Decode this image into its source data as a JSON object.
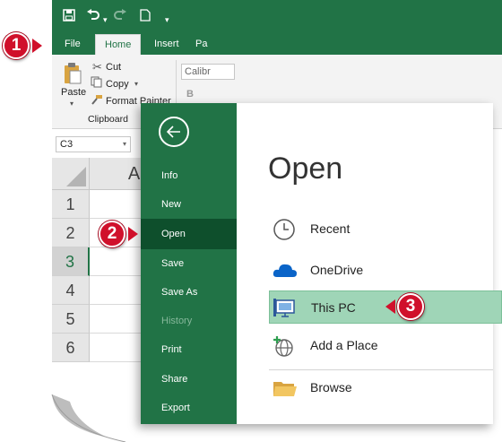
{
  "excel": {
    "quick_access": {
      "save_icon": "save-icon",
      "undo_icon": "undo-icon",
      "redo_icon": "redo-icon",
      "new_icon": "new-file-icon"
    },
    "tabs": [
      {
        "label": "File"
      },
      {
        "label": "Home"
      },
      {
        "label": "Insert"
      },
      {
        "label": "Pa"
      }
    ],
    "ribbon": {
      "paste_label": "Paste",
      "cut_label": "Cut",
      "copy_label": "Copy",
      "format_painter_label": "Format Painter",
      "font_name_partial": "Calibr",
      "bold_label": "B",
      "clipboard_group_label": "Clipboard"
    },
    "name_box": "C3",
    "column_header": "A",
    "row_headers": [
      "1",
      "2",
      "3",
      "4",
      "5",
      "6"
    ],
    "selected_row": "3"
  },
  "backstage": {
    "nav": [
      {
        "label": "Info",
        "state": "normal"
      },
      {
        "label": "New",
        "state": "normal"
      },
      {
        "label": "Open",
        "state": "active"
      },
      {
        "label": "Save",
        "state": "normal"
      },
      {
        "label": "Save As",
        "state": "normal"
      },
      {
        "label": "History",
        "state": "disabled"
      },
      {
        "label": "Print",
        "state": "normal"
      },
      {
        "label": "Share",
        "state": "normal"
      },
      {
        "label": "Export",
        "state": "normal"
      }
    ],
    "title": "Open",
    "locations": [
      {
        "label": "Recent",
        "icon": "clock-icon"
      },
      {
        "label": "OneDrive",
        "icon": "cloud-icon"
      },
      {
        "label": "This PC",
        "icon": "computer-icon",
        "selected": true
      },
      {
        "label": "Add a Place",
        "icon": "globe-plus-icon"
      },
      {
        "label": "Browse",
        "icon": "folder-icon"
      }
    ]
  },
  "callouts": [
    {
      "number": "1"
    },
    {
      "number": "2"
    },
    {
      "number": "3"
    }
  ],
  "colors": {
    "excel_green": "#217346",
    "nav_active": "#0e4f2c",
    "selection": "#9fd5b7",
    "callout_red": "#d0102b"
  }
}
